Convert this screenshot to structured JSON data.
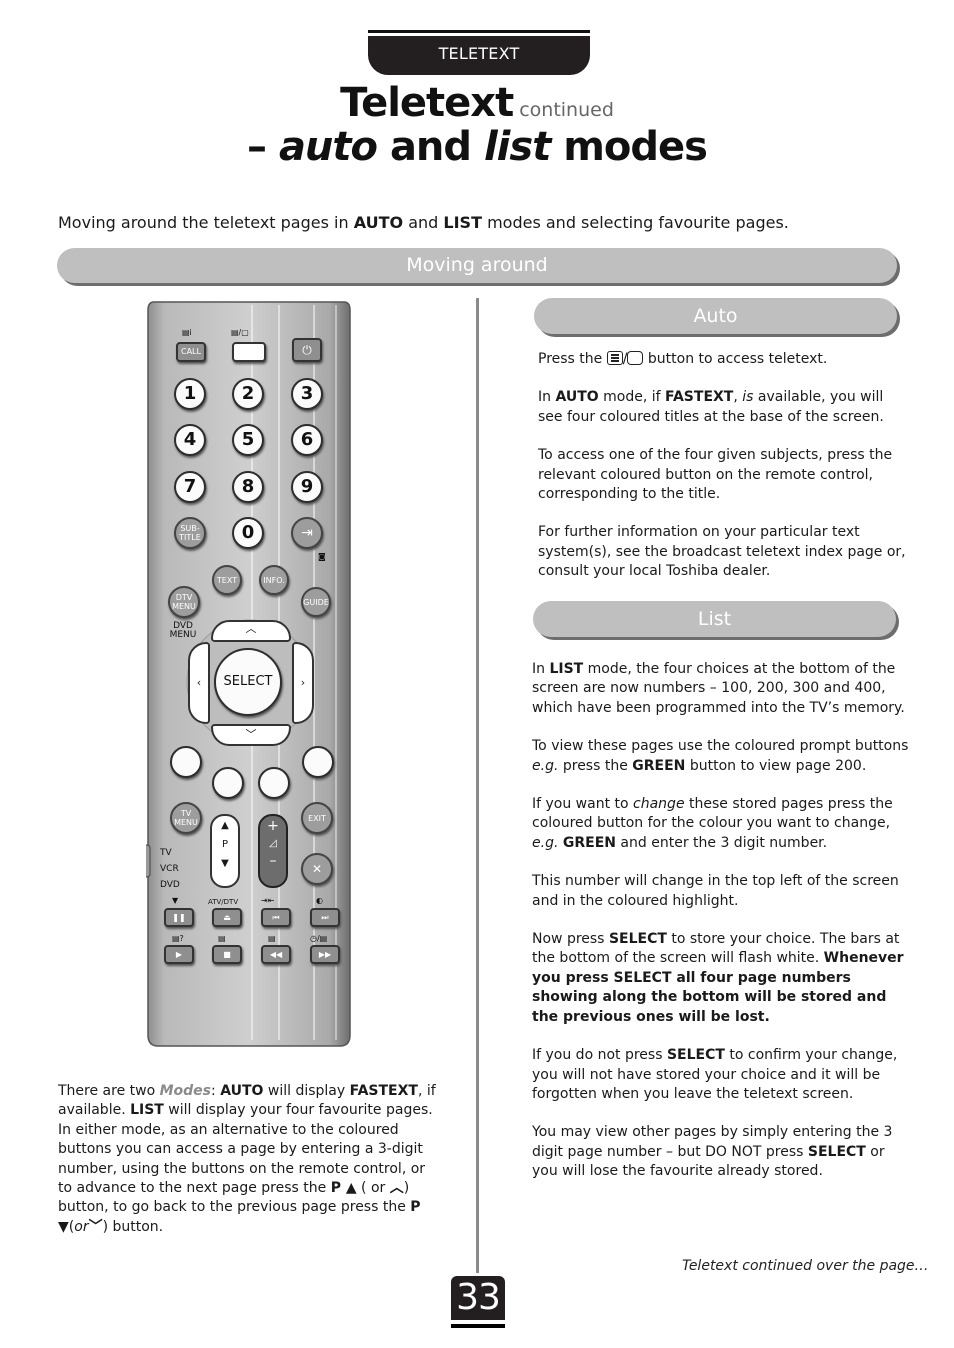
{
  "header": {
    "tab_label": "TELETEXT",
    "title_main": "Teletext",
    "title_suffix": "continued",
    "subtitle_dash": "– ",
    "subtitle_auto": "auto",
    "subtitle_and": " and ",
    "subtitle_list": "list",
    "subtitle_modes": " modes"
  },
  "intro": {
    "t1": "Moving around the teletext pages in ",
    "b1": "AUTO",
    "t2": " and ",
    "b2": "LIST",
    "t3": " modes and selecting favourite pages."
  },
  "sections": {
    "moving_around": "Moving around",
    "auto": "Auto",
    "list": "List"
  },
  "auto_text": {
    "p1_a": "Press the ",
    "p1_b": " button to access teletext.",
    "p2_a": "In ",
    "p2_b": "AUTO",
    "p2_c": " mode, if ",
    "p2_d": "FASTEXT",
    "p2_e": ", ",
    "p2_f": "is",
    "p2_g": " available, you will see four coloured titles at the base of the screen.",
    "p3": "To access one of the four given subjects, press the relevant coloured button on the remote control, corresponding to the title.",
    "p4": "For further information on your particular text system(s), see the broadcast teletext index page or, consult your local Toshiba dealer."
  },
  "list_text": {
    "p1_a": "In ",
    "p1_b": "LIST",
    "p1_c": " mode, the four choices at the bottom of the screen are now numbers – 100, 200, 300 and 400, which have been programmed into the TV’s memory.",
    "p2_a": "To view these pages use the coloured prompt buttons ",
    "p2_b": "e.g.",
    "p2_c": " press the ",
    "p2_d": "GREEN",
    "p2_e": " button to view page 200.",
    "p3_a": "If you want to ",
    "p3_b": "change",
    "p3_c": " these stored pages press the coloured button for the colour you want to change, ",
    "p3_d": "e.g.",
    "p3_e": " ",
    "p3_f": "GREEN",
    "p3_g": " and enter the 3 digit number.",
    "p4": "This number will change in the top left of the screen and in the coloured highlight.",
    "p5_a": "Now press ",
    "p5_b": "SELECT",
    "p5_c": " to store your choice. The bars at the bottom of the screen will flash white. ",
    "p5_d": "Whenever you press SELECT all four page numbers showing along the bottom will be stored and the previous ones will be lost.",
    "p6_a": "If you do not press ",
    "p6_b": "SELECT",
    "p6_c": " to confirm your change, you will not have stored your choice and it will be forgotten when you leave the teletext screen.",
    "p7_a": "You may view other pages by simply entering the 3 digit page number – but DO NOT press ",
    "p7_b": "SELECT",
    "p7_c": " or you will lose the favourite already stored."
  },
  "left_text": {
    "a": "There are two ",
    "modes": "Modes",
    "b": ": ",
    "auto": "AUTO",
    "c": " will display ",
    "fastext": "FASTEXT",
    "d": ", if available. ",
    "list": "LIST",
    "e": " will display your four favourite pages. In either mode, as an alternative to the coloured buttons you can access a page by entering a 3-digit number, using the buttons on the remote control, or to advance to the next page press the ",
    "p1": "P ▲",
    "f": " ( or ",
    "up_chevron": "︿",
    "g": ") button, to go back to the previous page press the ",
    "p2": "P ▼",
    "h": "(",
    "or": "or",
    "down_chevron": "﹀",
    "i": ") button."
  },
  "remote": {
    "call": "CALL",
    "digits": [
      "1",
      "2",
      "3",
      "4",
      "5",
      "6",
      "7",
      "8",
      "9",
      "0"
    ],
    "subtitle": "SUB-\nTITLE",
    "text": "TEXT",
    "info": "INFO.",
    "dtv_menu": "DTV MENU",
    "dvd_menu": "DVD MENU",
    "guide": "GUIDE",
    "select": "SELECT",
    "tv_menu": "TV MENU",
    "exit": "EXIT",
    "p_label": "P",
    "source_tv": "TV",
    "source_vcr": "VCR",
    "source_dvd": "DVD",
    "atv_dtv": "ATV/DTV"
  },
  "footer": {
    "continued": "Teletext continued over the page…",
    "page_number": "33"
  }
}
